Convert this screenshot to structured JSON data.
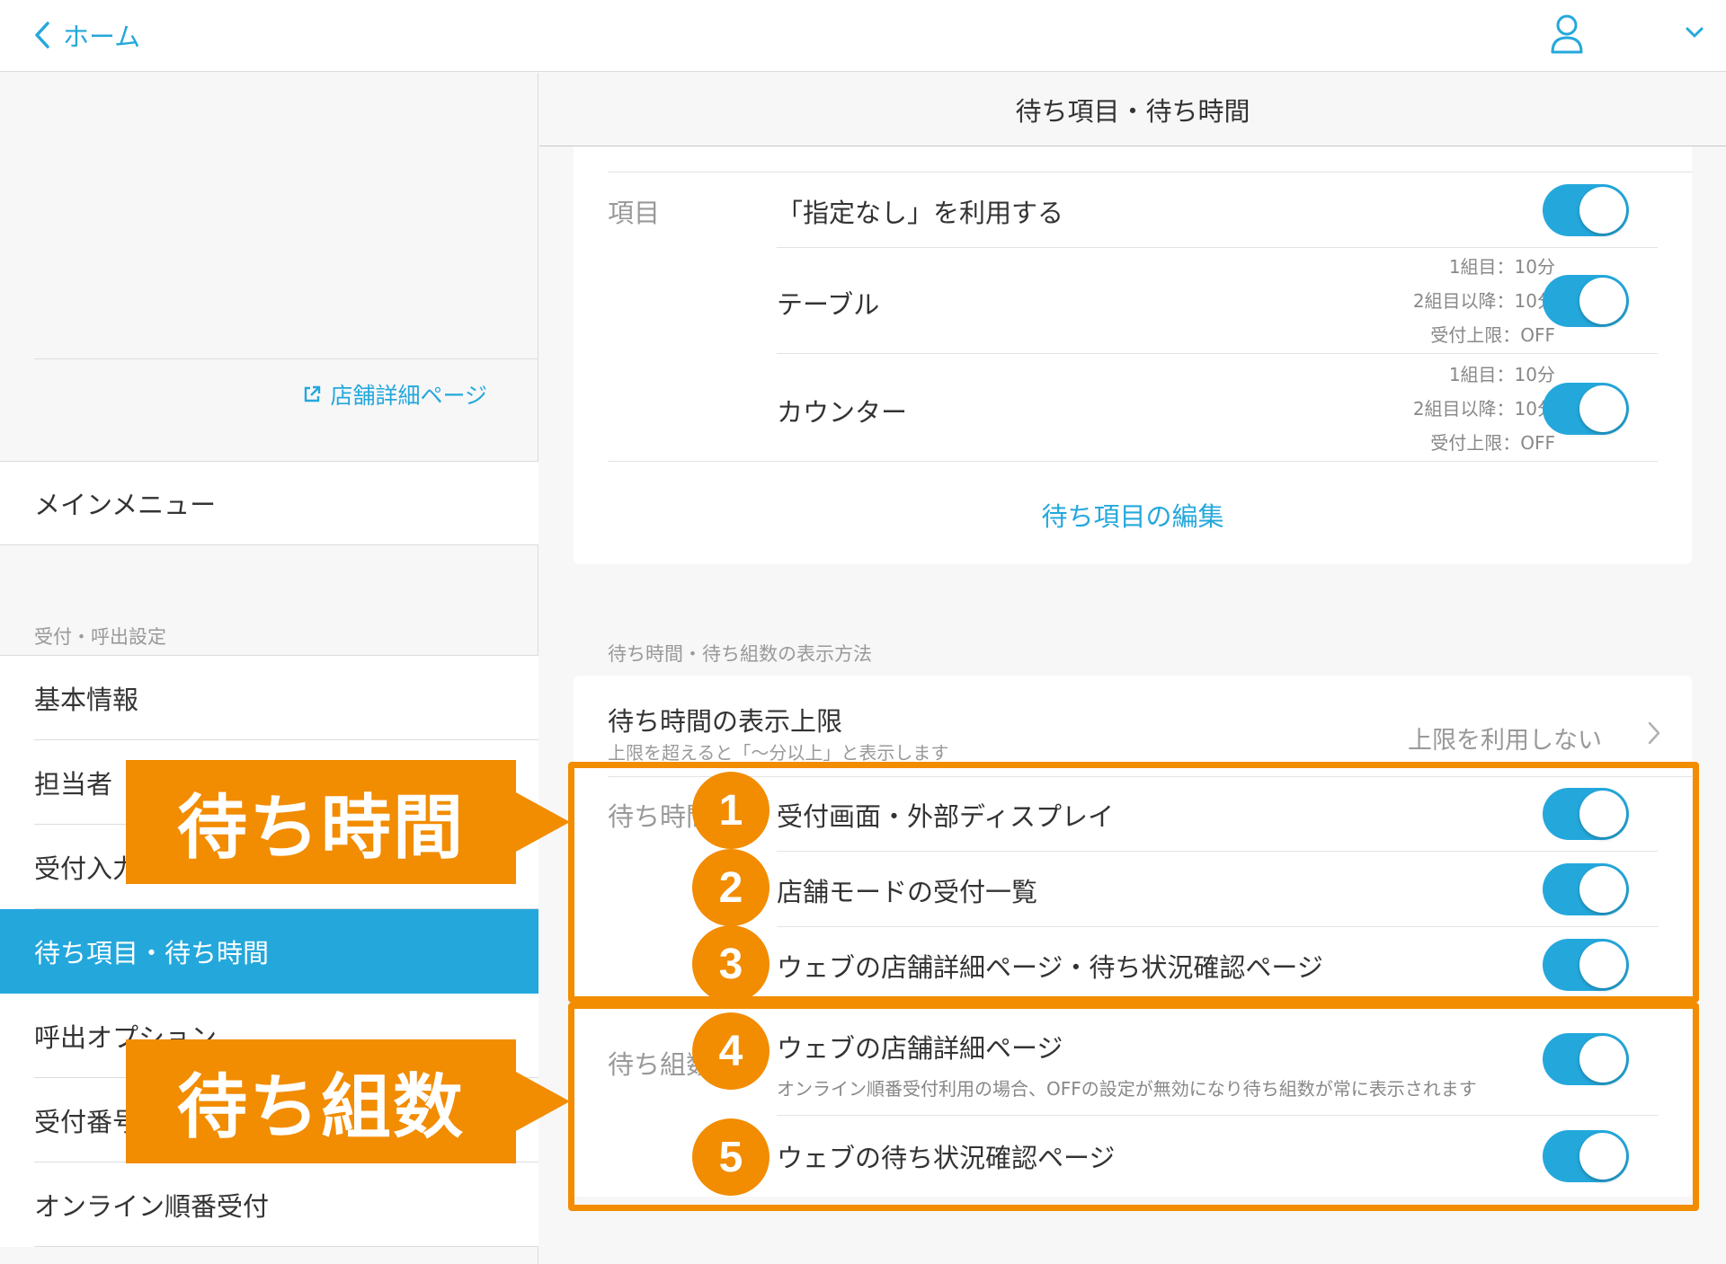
{
  "topbar": {
    "back_label": "ホーム"
  },
  "sidebar": {
    "store_link": "店舗詳細ページ",
    "main_menu": "メインメニュー",
    "section_label": "受付・呼出設定",
    "items": [
      {
        "label": "基本情報"
      },
      {
        "label": "担当者"
      },
      {
        "label": "受付入力"
      },
      {
        "label": "待ち項目・待ち時間",
        "active": true
      },
      {
        "label": "呼出オプション"
      },
      {
        "label": "受付番号"
      },
      {
        "label": "オンライン順番受付"
      }
    ]
  },
  "main": {
    "header_title": "待ち項目・待ち時間",
    "items_section": {
      "label": "項目",
      "rows": [
        {
          "title": "「指定なし」を利用する",
          "details": [],
          "on": true
        },
        {
          "title": "テーブル",
          "details": [
            "1組目：10分",
            "2組目以降：10分",
            "受付上限：OFF"
          ],
          "on": true
        },
        {
          "title": "カウンター",
          "details": [
            "1組目：10分",
            "2組目以降：10分",
            "受付上限：OFF"
          ],
          "on": true
        }
      ],
      "edit_link": "待ち項目の編集"
    },
    "display_section": {
      "label": "待ち時間・待ち組数の表示方法",
      "limit_title": "待ち時間の表示上限",
      "limit_subtitle": "上限を超えると「〜分以上」と表示します",
      "limit_value": "上限を利用しない",
      "wait_time_label": "待ち時間",
      "wait_count_label": "待ち組数",
      "wait_time_options": [
        {
          "num": "1",
          "title": "受付画面・外部ディスプレイ",
          "on": true
        },
        {
          "num": "2",
          "title": "店舗モードの受付一覧",
          "on": true
        },
        {
          "num": "3",
          "title": "ウェブの店舗詳細ページ・待ち状況確認ページ",
          "on": true
        }
      ],
      "wait_count_options": [
        {
          "num": "4",
          "title": "ウェブの店舗詳細ページ",
          "note": "オンライン順番受付利用の場合、OFFの設定が無効になり待ち組数が常に表示されます",
          "on": true
        },
        {
          "num": "5",
          "title": "ウェブの待ち状況確認ページ",
          "on": true
        }
      ]
    }
  },
  "annotations": {
    "callout_time": "待ち時間",
    "callout_count": "待ち組数"
  },
  "colors": {
    "accent": "#24a8dc",
    "annotation": "#f28c00"
  },
  "icons": {
    "back": "chevron-left-icon",
    "user": "user-icon",
    "menu": "chevron-down-icon",
    "external": "external-link-icon",
    "disclosure": "chevron-right-icon"
  }
}
